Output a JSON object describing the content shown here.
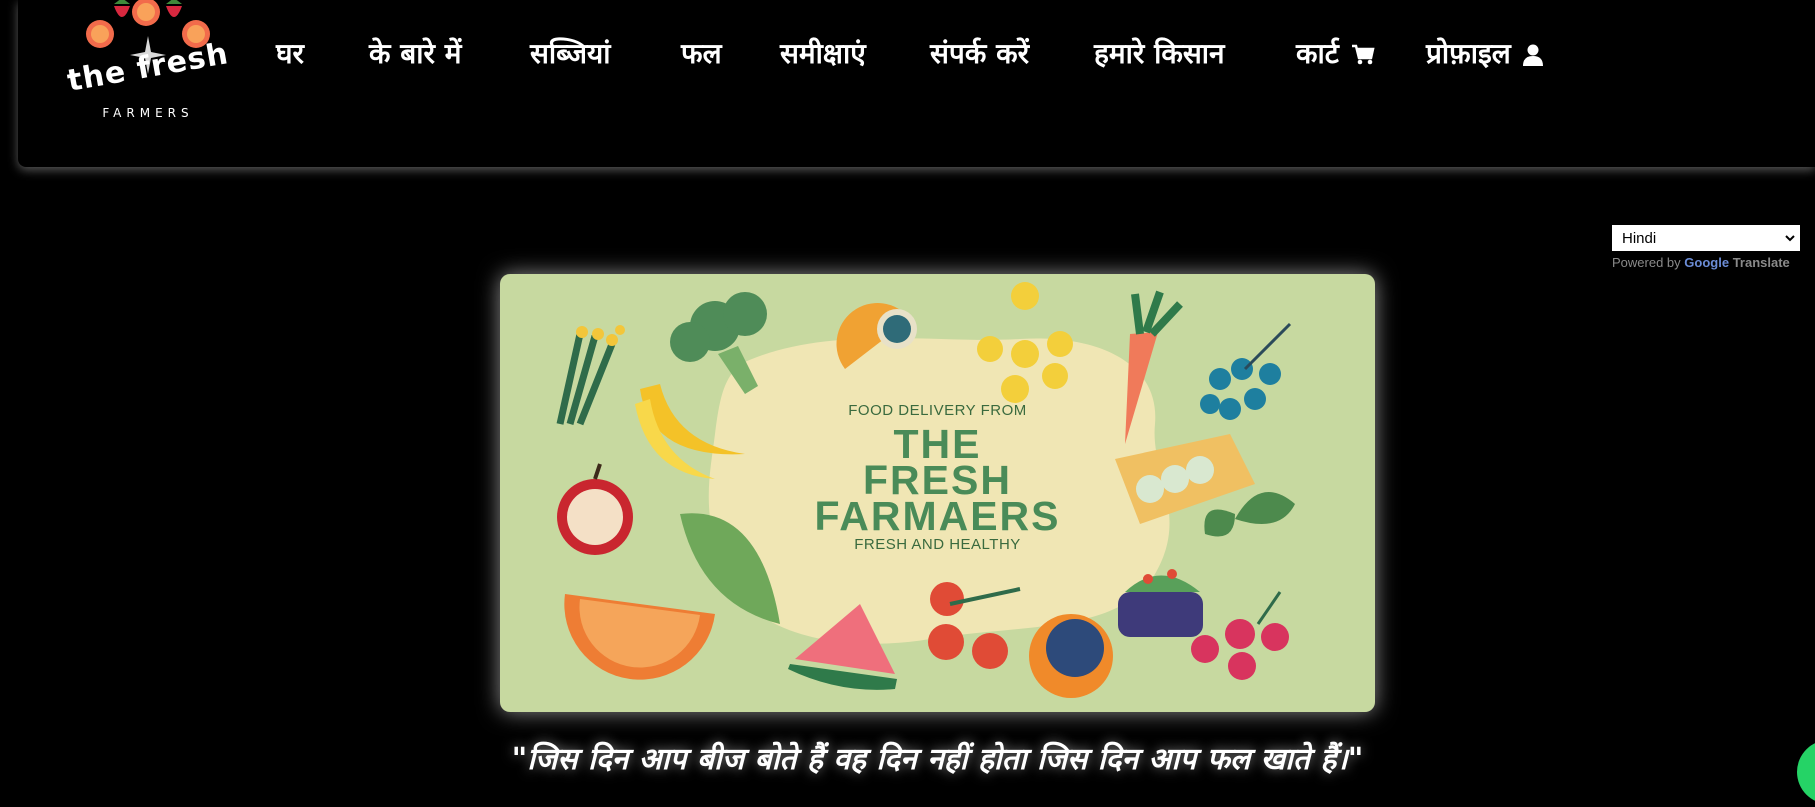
{
  "logo": {
    "brand": "the fresh",
    "sub": "FARMERS"
  },
  "nav": {
    "items": [
      {
        "label": "घर"
      },
      {
        "label": "के बारे में"
      },
      {
        "label": "सब्जियां"
      },
      {
        "label": "फल"
      },
      {
        "label": "समीक्षाएं"
      },
      {
        "label": "संपर्क करें"
      },
      {
        "label": "हमारे किसान"
      },
      {
        "label": "कार्ट",
        "icon": "cart-icon"
      },
      {
        "label": "प्रोफ़ाइल",
        "icon": "user-icon"
      }
    ]
  },
  "translate": {
    "selected": "Hindi",
    "powered_by": "Powered by",
    "google": "Google",
    "translate_word": "Translate"
  },
  "banner": {
    "line1": "FOOD DELIVERY FROM",
    "line2": "THE",
    "line3": "FRESH",
    "line4": "FARMAERS",
    "line5": "FRESH AND HEALTHY"
  },
  "quote": "\"जिस दिन आप बीज बोते हैं वह दिन नहीं होता जिस दिन आप फल खाते हैं।\"",
  "colors": {
    "background": "#000000",
    "banner_bg": "#c7d9a0",
    "banner_blob": "#f0e6b4",
    "title_green": "#4a8b58",
    "chat": "#25d366"
  }
}
